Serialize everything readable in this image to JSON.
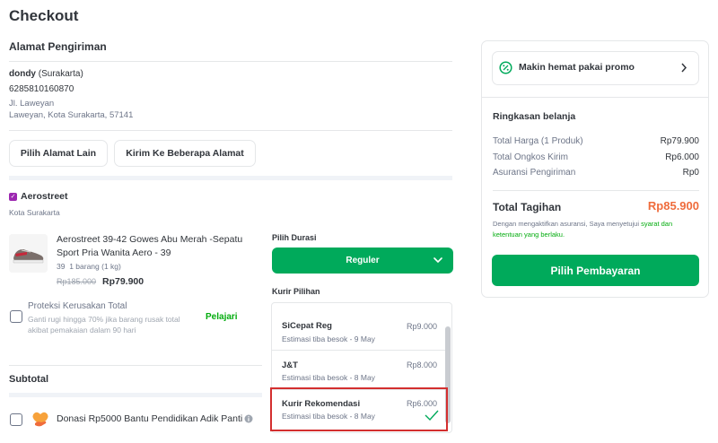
{
  "page": {
    "title": "Checkout"
  },
  "address": {
    "section_title": "Alamat Pengiriman",
    "recipient_name": "dondy",
    "recipient_city": "(Surakarta)",
    "phone": "6285810160870",
    "street": "Jl. Laweyan",
    "city_line": "Laweyan, Kota Surakarta, 57141",
    "choose_other_label": "Pilih Alamat Lain",
    "multi_address_label": "Kirim Ke Beberapa Alamat"
  },
  "shop": {
    "name": "Aerostreet",
    "city": "Kota Surakarta",
    "badge_icon": "shop-badge-icon",
    "badge_color": "#9c27b0"
  },
  "product": {
    "name": "Aerostreet 39-42 Gowes Abu Merah -Sepatu Sport Pria Wanita Aero - 39",
    "variant": "39",
    "quantity_weight": "1 barang (1 kg)",
    "original_price": "Rp185.000",
    "price": "Rp79.900"
  },
  "protection": {
    "title": "Proteksi Kerusakan Total",
    "description": "Ganti rugi hingga 70% jika barang rusak total akibat pemakaian dalam 90 hari",
    "learn_label": "Pelajari",
    "checked": false
  },
  "shipping": {
    "duration_label": "Pilih Durasi",
    "duration_value": "Reguler",
    "courier_label": "Kurir Pilihan",
    "couriers": [
      {
        "name": "SiCepat Reg",
        "estimate": "Estimasi tiba besok - 9 May",
        "price": "Rp9.000",
        "selected": false
      },
      {
        "name": "J&T",
        "estimate": "Estimasi tiba besok - 8 May",
        "price": "Rp8.000",
        "selected": false
      },
      {
        "name": "Kurir Rekomendasi",
        "estimate": "Estimasi tiba besok - 8 May",
        "price": "Rp6.000",
        "selected": true
      }
    ]
  },
  "subtotal": {
    "label": "Subtotal"
  },
  "donation": {
    "label": "Donasi Rp5000 Bantu Pendidikan Adik Panti",
    "checked": false
  },
  "promo": {
    "label": "Makin hemat pakai promo",
    "icon": "percent-badge-icon"
  },
  "summary": {
    "title": "Ringkasan belanja",
    "rows": [
      {
        "label": "Total Harga (1 Produk)",
        "value": "Rp79.900"
      },
      {
        "label": "Total Ongkos Kirim",
        "value": "Rp6.000"
      },
      {
        "label": "Asuransi Pengiriman",
        "value": "Rp0"
      }
    ],
    "total_label": "Total Tagihan",
    "total_value": "Rp85.900",
    "disclaimer_prefix": "Dengan mengaktifkan asuransi, Saya menyetujui",
    "disclaimer_link": "syarat dan ketentuan yang berlaku.",
    "pay_button": "Pilih Pembayaran"
  },
  "colors": {
    "accent_green": "#00aa5b",
    "total_orange": "#ef6c3c",
    "highlight_red": "#d32f2f"
  }
}
